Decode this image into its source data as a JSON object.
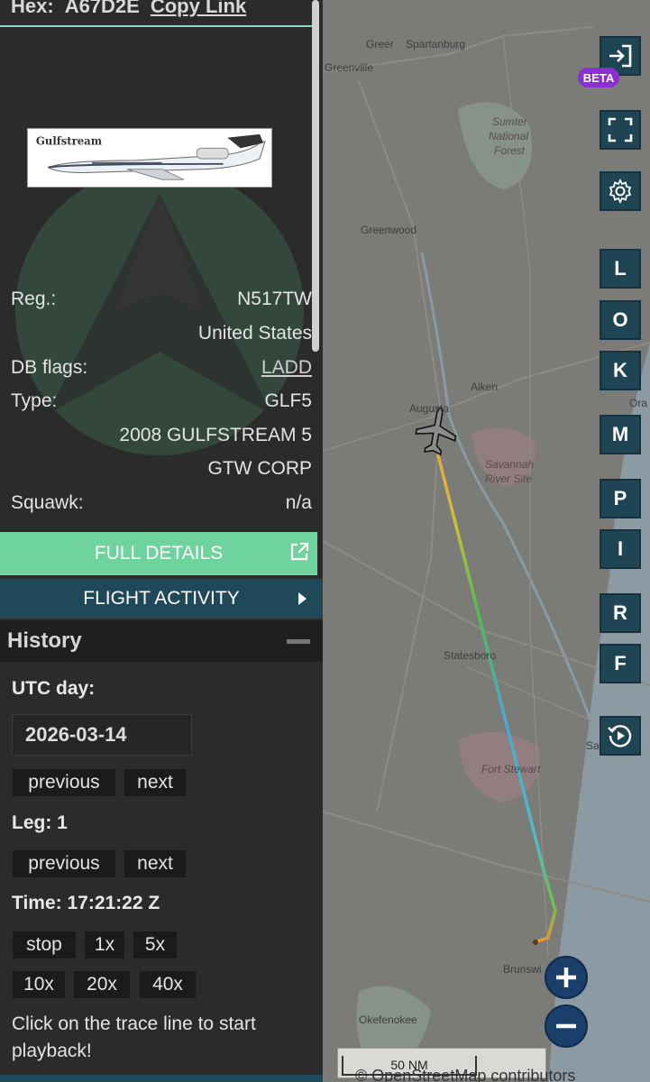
{
  "header": {
    "hex_label": "Hex:",
    "hex_value": "A67D2E",
    "copy_link": "Copy Link"
  },
  "aircraft_photo": {
    "airline_text": "Gulfstream"
  },
  "info": {
    "reg_label": "Reg.:",
    "reg_value": "N517TW",
    "country": "United States",
    "db_flags_label": "DB flags:",
    "db_flags_value": "LADD",
    "type_label": "Type:",
    "type_value": "GLF5",
    "type_desc": "2008 GULFSTREAM 5",
    "owner": "GTW CORP",
    "squawk_label": "Squawk:",
    "squawk_value": "n/a"
  },
  "buttons": {
    "full_details": "FULL DETAILS",
    "flight_activity": "FLIGHT ACTIVITY"
  },
  "history": {
    "title": "History",
    "utc_day_label": "UTC day:",
    "date": "2026-03-14",
    "prev": "previous",
    "next": "next",
    "leg_label": "Leg: 1",
    "time_label": "Time: 17:21:22 Z",
    "speed": [
      "stop",
      "1x",
      "5x",
      "10x",
      "20x",
      "40x"
    ],
    "hint": "Click on the trace line to start playback!"
  },
  "map": {
    "labels": {
      "greer": "Greer",
      "spartanburg": "Spartanburg",
      "greenville": "Greenville",
      "sumter": "Sumter",
      "national": "National",
      "forest": "Forest",
      "greenwood": "Greenwood",
      "aiken": "Aiken",
      "augusta": "Augusta",
      "savannah": "Savannah",
      "river_site": "River Site",
      "statesboro": "Statesboro",
      "fort_stewart": "Fort Stewart",
      "brunswick": "Brunswi",
      "okefenokee": "Okefenokee",
      "ora": "Ora",
      "sa": "Sa"
    },
    "controls": {
      "beta": "BETA",
      "letters": [
        "L",
        "O",
        "K",
        "M",
        "P",
        "I",
        "R",
        "F"
      ]
    },
    "scale": "50 NM",
    "attribution": "© OpenStreetMap contributors",
    "colors": {
      "accent_green": "#6fd39d",
      "dark_teal": "#1f4858",
      "beta_purple": "#8a2fd4"
    }
  }
}
